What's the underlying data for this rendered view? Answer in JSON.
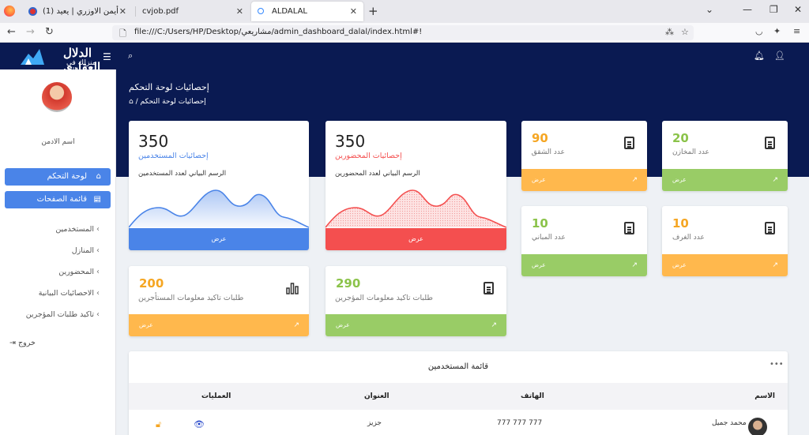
{
  "browser": {
    "tabs": [
      {
        "label": "أيمن الاوزري | يعيد (1)"
      },
      {
        "label": "cvjob.pdf"
      },
      {
        "label": "ALDALAL"
      }
    ],
    "url": "file:///C:/Users/HP/Desktop/مشاريعي/admin_dashboard_dalal/index.html#!"
  },
  "app": {
    "logo_line1": "الدلال العقاري",
    "logo_line2": "منزلك في جوالك"
  },
  "sidebar": {
    "admin_name": "اسم الادمن",
    "dashboard_btn": "لوحة التحكم",
    "pages_btn": "قائمة الصفحات",
    "items": [
      {
        "label": "المستخدمين"
      },
      {
        "label": "المنازل"
      },
      {
        "label": "المحضورين"
      },
      {
        "label": "الاحصائيات البيانية"
      },
      {
        "label": "تاكيد طلبات المؤجرين"
      }
    ],
    "logout": "خروج"
  },
  "header": {
    "title": "إحصائيات لوحة التحكم",
    "breadcrumb": "إحصائيات لوحة التحكم"
  },
  "cards": {
    "users": {
      "value": "350",
      "label": "إحصائيات المستخدمين",
      "desc": "الرسم البياني لعدد المستخدمين",
      "footer": "عرض",
      "color": "#4a84e8"
    },
    "blocked": {
      "value": "350",
      "label": "إحصائيات المحضورين",
      "desc": "الرسم البياني لعدد المحضورين",
      "footer": "عرض",
      "color": "#f44f4f"
    },
    "apartments": {
      "value": "90",
      "label": "عدد الشقق",
      "footer": "عرض",
      "color": "#ffb84d"
    },
    "stores": {
      "value": "20",
      "label": "عدد المخازن",
      "footer": "عرض",
      "color": "#99cc66"
    },
    "buildings": {
      "value": "10",
      "label": "عدد المباني",
      "footer": "عرض",
      "color": "#99cc66"
    },
    "rooms": {
      "value": "10",
      "label": "عدد الغرف",
      "footer": "عرض",
      "color": "#ffb84d"
    },
    "renters": {
      "value": "200",
      "label": "طلبات تاكيد معلومات المستأجرين",
      "footer": "عرض",
      "color": "#ffb84d"
    },
    "owners": {
      "value": "290",
      "label": "طلبات تاكيد معلومات المؤجرين",
      "footer": "عرض",
      "color": "#99cc66"
    }
  },
  "users_table": {
    "title": "قائمة المستخدمين",
    "columns": [
      "الاسم",
      "الهاتف",
      "العنوان",
      "العمليات"
    ],
    "rows": [
      {
        "name": "محمد جميل",
        "phone": "777 777 777",
        "address": "جزيز"
      }
    ]
  }
}
